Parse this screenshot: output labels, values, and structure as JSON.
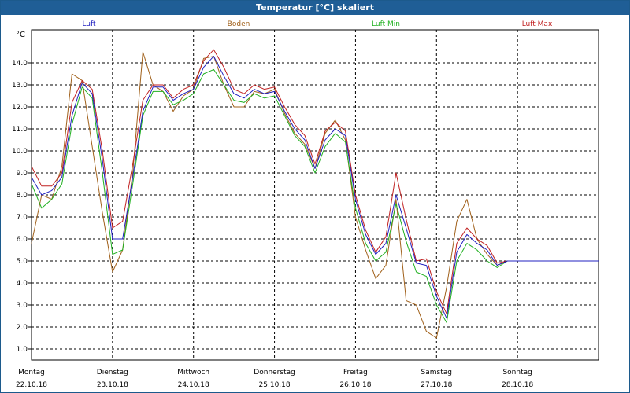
{
  "window": {
    "title": "Temperatur [°C] skaliert"
  },
  "colors": {
    "titlebar": "#1f5e96",
    "grid": "#000000",
    "Luft": "#2020c0",
    "Boden": "#a0601a",
    "Luft Min": "#20b020",
    "Luft Max": "#c02020"
  },
  "chart_data": {
    "type": "line",
    "title": "Temperatur [°C] skaliert",
    "ylabel": "°C",
    "xlabel": "",
    "ylim": [
      0.5,
      15.5
    ],
    "xlim": [
      0,
      7
    ],
    "grid": true,
    "legend_position": "top",
    "y_ticks": [
      "1.0",
      "2.0",
      "3.0",
      "4.0",
      "5.0",
      "6.0",
      "7.0",
      "8.0",
      "9.0",
      "10.0",
      "11.0",
      "12.0",
      "13.0",
      "14.0"
    ],
    "x_ticks": [
      {
        "day": "Montag",
        "date": "22.10.18"
      },
      {
        "day": "Dienstag",
        "date": "23.10.18"
      },
      {
        "day": "Mittwoch",
        "date": "24.10.18"
      },
      {
        "day": "Donnerstag",
        "date": "25.10.18"
      },
      {
        "day": "Freitag",
        "date": "26.10.18"
      },
      {
        "day": "Samstag",
        "date": "27.10.18"
      },
      {
        "day": "Sonntag",
        "date": "28.10.18"
      }
    ],
    "x": [
      0,
      0.125,
      0.25,
      0.375,
      0.5,
      0.625,
      0.75,
      0.875,
      1,
      1.125,
      1.25,
      1.375,
      1.5,
      1.625,
      1.75,
      1.875,
      2,
      2.125,
      2.25,
      2.375,
      2.5,
      2.625,
      2.75,
      2.875,
      3,
      3.125,
      3.25,
      3.375,
      3.5,
      3.625,
      3.75,
      3.875,
      4,
      4.125,
      4.25,
      4.375,
      4.5,
      4.625,
      4.75,
      4.875,
      5,
      5.125,
      5.25,
      5.375,
      5.5,
      5.625,
      5.75,
      5.875,
      6,
      6.125,
      6.25,
      6.375,
      6.5,
      6.625,
      6.75,
      6.875,
      7
    ],
    "series": [
      {
        "name": "Luft",
        "values": [
          8.8,
          8.0,
          8.2,
          8.8,
          11.6,
          13.1,
          12.6,
          9.6,
          6.0,
          6.0,
          8.8,
          11.8,
          12.9,
          12.9,
          12.3,
          12.6,
          12.8,
          13.8,
          14.3,
          13.4,
          12.6,
          12.4,
          12.8,
          12.6,
          12.7,
          11.8,
          11.0,
          10.5,
          9.2,
          10.5,
          11.0,
          10.7,
          7.8,
          6.2,
          5.3,
          5.8,
          8.0,
          6.5,
          4.9,
          4.8,
          3.4,
          2.4,
          5.4,
          6.2,
          5.8,
          5.5,
          4.8,
          5.0,
          5.0,
          5.0,
          5.0,
          5.0,
          5.0,
          5.0,
          5.0,
          5.0,
          5.0
        ]
      },
      {
        "name": "Boden",
        "values": [
          5.8,
          8.0,
          7.8,
          9.3,
          13.5,
          13.2,
          10.2,
          7.2,
          4.5,
          5.5,
          9.0,
          14.5,
          13.0,
          12.7,
          11.8,
          12.5,
          12.8,
          14.2,
          14.3,
          13.0,
          12.0,
          12.0,
          12.7,
          12.6,
          12.8,
          11.7,
          10.8,
          10.3,
          9.2,
          10.8,
          11.4,
          10.5,
          7.0,
          5.5,
          4.2,
          4.8,
          7.8,
          3.2,
          3.0,
          1.8,
          1.5,
          3.8,
          6.8,
          7.8,
          6.0,
          5.3,
          4.8,
          5.0,
          5.0,
          5.0,
          5.0,
          5.0,
          5.0,
          5.0,
          5.0,
          5.0,
          5.0
        ]
      },
      {
        "name": "Luft Min",
        "values": [
          8.5,
          7.4,
          7.8,
          8.5,
          11.2,
          12.9,
          12.4,
          9.0,
          5.3,
          5.5,
          8.5,
          11.6,
          12.7,
          12.7,
          12.1,
          12.3,
          12.6,
          13.5,
          13.7,
          13.0,
          12.3,
          12.2,
          12.6,
          12.4,
          12.5,
          11.6,
          10.7,
          10.2,
          9.0,
          10.2,
          10.8,
          10.4,
          7.4,
          5.8,
          5.0,
          5.4,
          7.6,
          5.9,
          4.5,
          4.3,
          3.0,
          2.2,
          5.0,
          5.8,
          5.5,
          5.0,
          4.7,
          5.0,
          5.0,
          5.0,
          5.0,
          5.0,
          5.0,
          5.0,
          5.0,
          5.0,
          5.0
        ]
      },
      {
        "name": "Luft Max",
        "values": [
          9.3,
          8.4,
          8.4,
          9.0,
          12.2,
          13.2,
          12.8,
          10.0,
          6.5,
          6.8,
          9.4,
          12.3,
          13.0,
          13.0,
          12.4,
          12.8,
          13.0,
          14.1,
          14.6,
          13.8,
          12.8,
          12.6,
          13.0,
          12.8,
          12.9,
          12.0,
          11.2,
          10.7,
          9.4,
          10.9,
          11.3,
          10.9,
          8.0,
          6.4,
          5.4,
          6.1,
          9.0,
          6.9,
          5.0,
          5.1,
          3.6,
          2.6,
          5.8,
          6.5,
          6.0,
          5.7,
          4.9,
          5.0,
          5.0,
          5.0,
          5.0,
          5.0,
          5.0,
          5.0,
          5.0,
          5.0,
          5.0
        ]
      }
    ]
  }
}
